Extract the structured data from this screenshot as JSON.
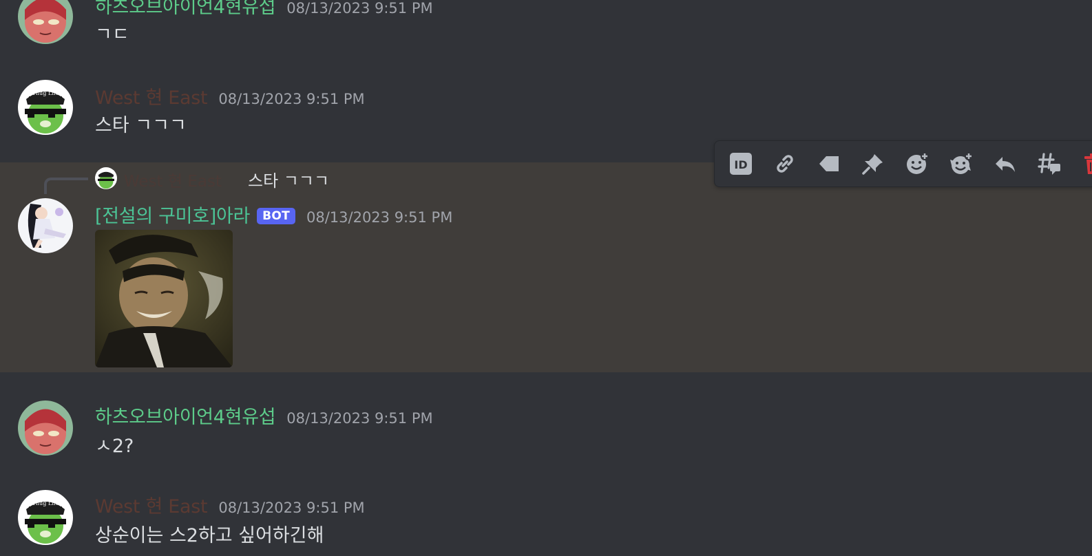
{
  "messages": [
    {
      "username": "하츠오브아이언4현유섭",
      "timestamp": "08/13/2023 9:51 PM",
      "text": "ㄱㄷ"
    },
    {
      "username": "West 현 East",
      "timestamp": "08/13/2023 9:51 PM",
      "text": "스타 ㄱㄱㄱ"
    },
    {
      "username": "[전설의 구미호]아라",
      "badge": "BOT",
      "timestamp": "08/13/2023 9:51 PM",
      "reply": {
        "username": "West 현 East",
        "text": "스타 ㄱㄱㄱ"
      },
      "attachment": "gif-image"
    },
    {
      "username": "하츠오브아이언4현유섭",
      "timestamp": "08/13/2023 9:51 PM",
      "text": "ㅅ2?"
    },
    {
      "username": "West 현 East",
      "timestamp": "08/13/2023 9:51 PM",
      "text": "상순이는 스2하고 싶어하긴해"
    }
  ],
  "toolbar": {
    "icons": [
      "id-icon",
      "link-icon",
      "tag-icon",
      "pin-icon",
      "add-reaction-icon",
      "super-reaction-icon",
      "reply-icon",
      "thread-icon",
      "delete-icon"
    ]
  },
  "colors": {
    "background": "#313338",
    "highlight": "#403d3a",
    "username_green": "#5dcc8a",
    "username_brown": "#5b3a32",
    "username_teal": "#4cc496",
    "bot_badge": "#5865f2",
    "delete": "#da373c"
  }
}
